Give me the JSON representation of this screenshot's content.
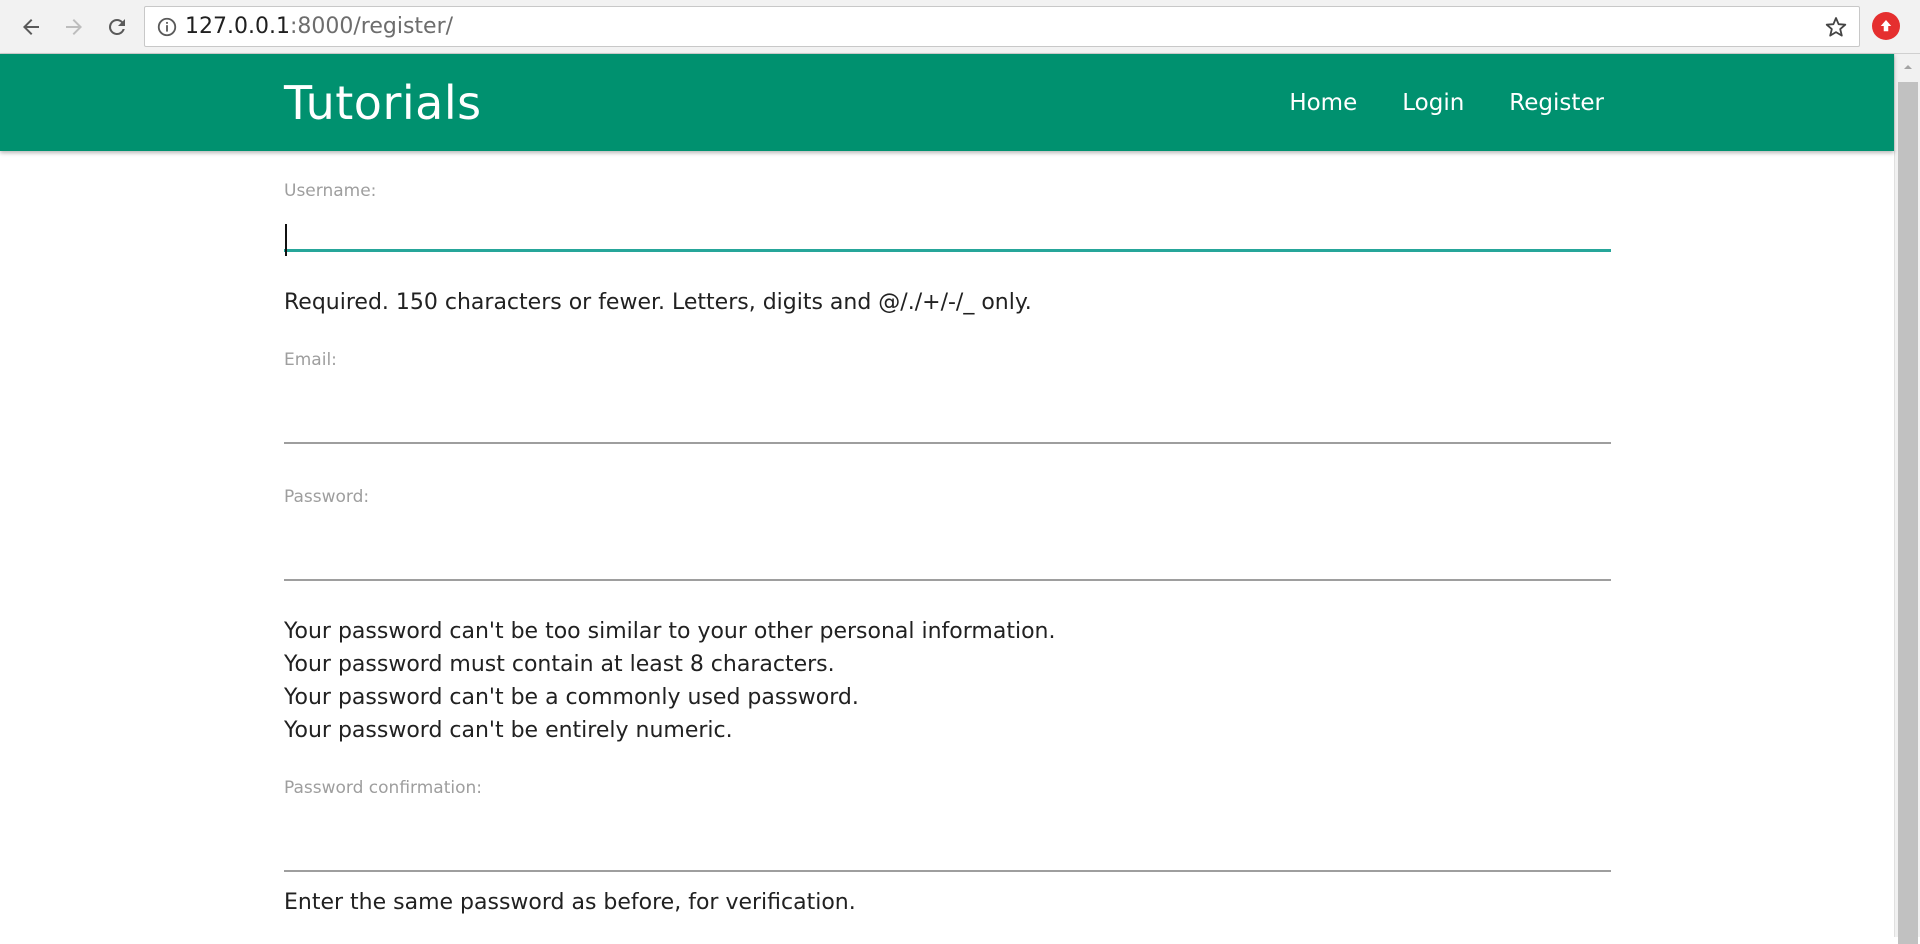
{
  "browser": {
    "url_host": "127.0.0.1",
    "url_path": ":8000/register/"
  },
  "nav": {
    "brand": "Tutorials",
    "links": [
      "Home",
      "Login",
      "Register"
    ]
  },
  "form": {
    "username": {
      "label": "Username:",
      "value": "",
      "help": "Required. 150 characters or fewer. Letters, digits and @/./+/-/_ only."
    },
    "email": {
      "label": "Email:",
      "value": ""
    },
    "password": {
      "label": "Password:",
      "value": "",
      "help": [
        "Your password can't be too similar to your other personal information.",
        "Your password must contain at least 8 characters.",
        "Your password can't be a commonly used password.",
        "Your password can't be entirely numeric."
      ]
    },
    "password_confirmation": {
      "label": "Password confirmation:",
      "value": "",
      "help": "Enter the same password as before, for verification."
    }
  },
  "colors": {
    "nav_bg": "#00916f",
    "focus_underline": "#26a69a",
    "label_gray": "#9e9e9e"
  },
  "icons": [
    "back-arrow-icon",
    "forward-arrow-icon",
    "reload-icon",
    "info-icon",
    "star-icon",
    "extension-icon"
  ]
}
